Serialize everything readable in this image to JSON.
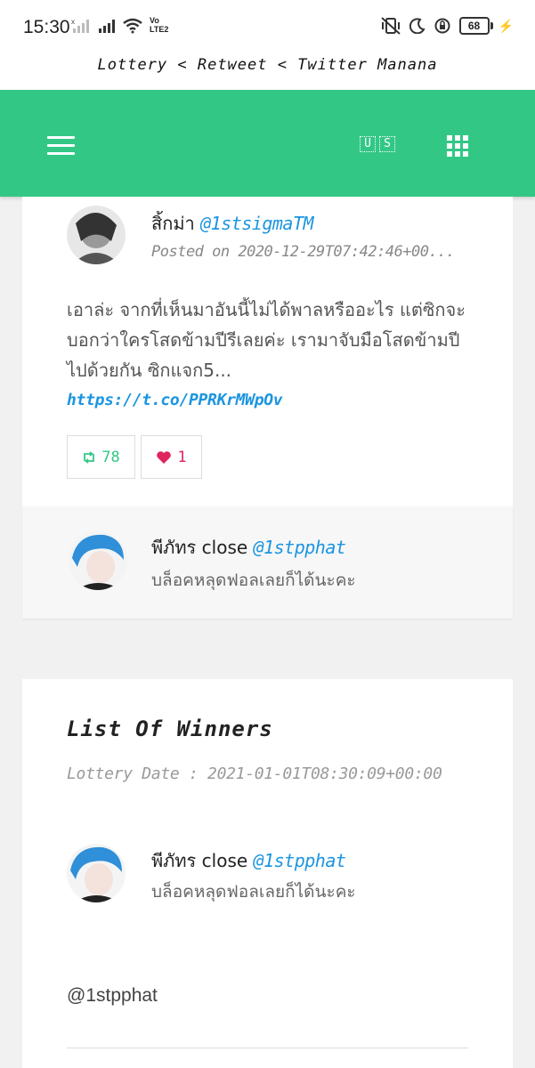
{
  "status_bar": {
    "time": "15:30",
    "volte": "Vo LTE2",
    "battery": "68"
  },
  "page_title": "Lottery < Retweet < Twitter Manana",
  "navbar": {
    "lang_letters": [
      "U",
      "S"
    ],
    "accent": "#33c786"
  },
  "tweet": {
    "author_name": "สิ้กม่า",
    "author_handle": "@1stsigmaTM",
    "posted": "Posted on 2020-12-29T07:42:46+00...",
    "text": "เอาล่ะ จากที่เห็นมาอันนี้ไม่ได้พาลหรืออะไร แต่ซิกจะบอกว่าใครโสดข้ามปีรีเลยค่ะ เรามาจับมือโสดข้ามปีไปด้วยกัน ซิกแจก5...",
    "link": "https://t.co/PPRKrMWpOv",
    "retweets": "78",
    "likes": "1"
  },
  "reply": {
    "name": "พีภัทร close",
    "handle": "@1stpphat",
    "text": "บล็อคหลุดฟอลเลยก็ได้นะคะ"
  },
  "winners": {
    "title": "List Of Winners",
    "lottery_date": "Lottery Date : 2021-01-01T08:30:09+00:00",
    "winner_name": "พีภัทร close",
    "winner_handle": "@1stpphat",
    "winner_text": "บล็อคหลุดฟอลเลยก็ได้นะคะ",
    "winner_plain_handle": "@1stpphat"
  }
}
